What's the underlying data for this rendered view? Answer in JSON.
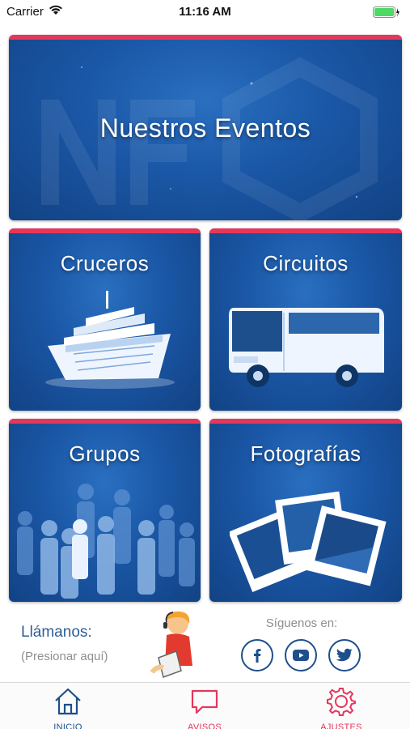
{
  "status_bar": {
    "carrier": "Carrier",
    "time": "11:16 AM"
  },
  "cards": {
    "hero": {
      "title": "Nuestros Eventos"
    },
    "cruceros": {
      "title": "Cruceros"
    },
    "circuitos": {
      "title": "Circuitos"
    },
    "grupos": {
      "title": "Grupos"
    },
    "fotografias": {
      "title": "Fotografías"
    }
  },
  "contact": {
    "title": "Llámanos:",
    "hint": "(Presionar aquí)"
  },
  "social": {
    "label": "Síguenos en:",
    "networks": [
      "facebook-icon",
      "youtube-icon",
      "twitter-icon"
    ]
  },
  "tabs": [
    {
      "label": "INICIO",
      "icon": "home-icon"
    },
    {
      "label": "AVISOS",
      "icon": "message-icon"
    },
    {
      "label": "AJUSTES",
      "icon": "gear-icon"
    }
  ],
  "colors": {
    "accent": "#e6375b",
    "brand_blue": "#1d4f8c",
    "card_blue": "#1a57a6"
  }
}
